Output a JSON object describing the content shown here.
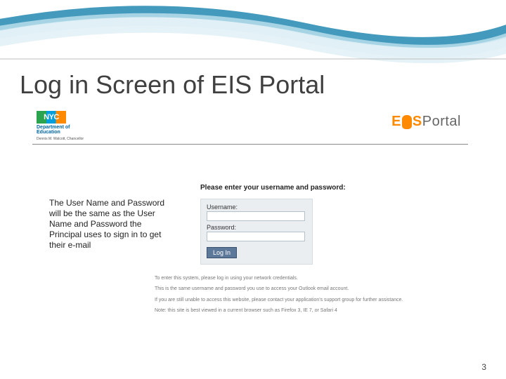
{
  "slide": {
    "title": "Log in Screen of EIS Portal",
    "page_number": "3"
  },
  "header": {
    "nyc_text": "NYC",
    "dept_line1": "Department of",
    "dept_line2": "Education",
    "chancellor": "Dennis M. Walcott, Chancellor",
    "eis_e": "E",
    "eis_s": "S",
    "eis_portal": "Portal"
  },
  "login": {
    "heading": "Please enter your username and password:",
    "username_label": "Username:",
    "password_label": "Password:",
    "button": "Log In"
  },
  "help": {
    "line1": "To enter this system, please log in using your network credentials.",
    "line2": "This is the same username and password you use to access your Outlook email account.",
    "line3": "If you are still unable to access this website, please contact your application's support group for further assistance.",
    "note": "Note: this site is best viewed in a current browser such as Firefox 3, IE 7, or Safari 4"
  },
  "callout": {
    "text": "The User Name and Password will be the same as the User Name and Password the Principal uses to sign in to get their e-mail"
  }
}
